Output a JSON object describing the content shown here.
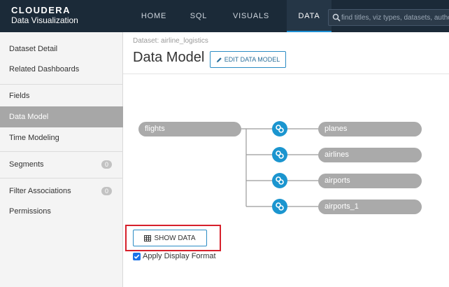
{
  "brand": {
    "name": "CLOUDERA",
    "product": "Data Visualization"
  },
  "nav": {
    "items": [
      "HOME",
      "SQL",
      "VISUALS",
      "DATA"
    ],
    "active": "DATA"
  },
  "search": {
    "placeholder": "find titles, viz types, datasets, authors, ..."
  },
  "sidebar": {
    "items": [
      {
        "label": "Dataset Detail"
      },
      {
        "label": "Related Dashboards"
      },
      {
        "label": "Fields"
      },
      {
        "label": "Data Model"
      },
      {
        "label": "Time Modeling"
      },
      {
        "label": "Segments",
        "badge": "0"
      },
      {
        "label": "Filter Associations",
        "badge": "0"
      },
      {
        "label": "Permissions"
      }
    ],
    "active": "Data Model"
  },
  "main": {
    "breadcrumb": "Dataset: airline_logistics",
    "title": "Data Model",
    "edit_button": "EDIT DATA MODEL"
  },
  "data_model": {
    "source_table": "flights",
    "joined_tables": [
      "planes",
      "airlines",
      "airports",
      "airports_1"
    ]
  },
  "actions": {
    "show_data": "SHOW DATA",
    "apply_display_format": "Apply Display Format",
    "apply_display_format_checked": true
  },
  "colors": {
    "topbar": "#1b2a38",
    "accent": "#1b95cf",
    "pill": "#aaaaaa",
    "highlight": "#d6202b"
  }
}
